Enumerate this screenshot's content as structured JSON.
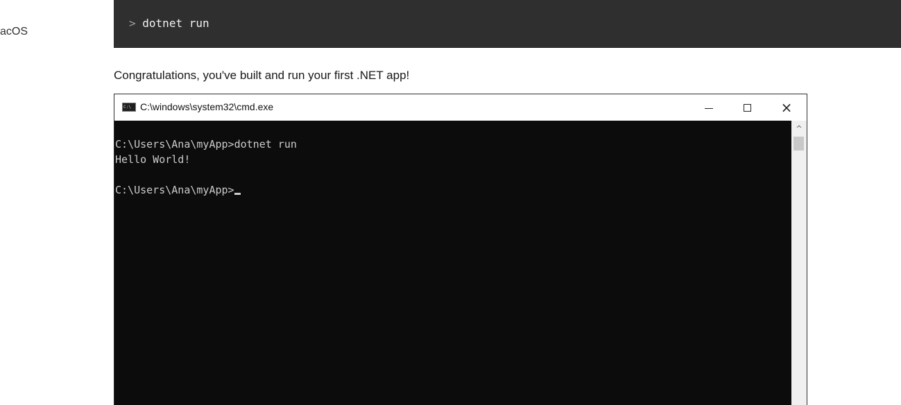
{
  "sidebar": {
    "label": "acOS"
  },
  "code_block": {
    "prompt": ">",
    "command": "dotnet run"
  },
  "message": "Congratulations, you've built and run your first .NET app!",
  "cmd_window": {
    "title": "C:\\windows\\system32\\cmd.exe",
    "icon_text": "C:\\",
    "lines": [
      "C:\\Users\\Ana\\myApp>dotnet run",
      "Hello World!",
      "",
      "C:\\Users\\Ana\\myApp>"
    ],
    "close_glyph": "×",
    "scroll_up_glyph": "^"
  },
  "colors": {
    "code_bg": "#2f2f2f",
    "console_bg": "#0c0c0c",
    "console_text": "#cccccc"
  }
}
